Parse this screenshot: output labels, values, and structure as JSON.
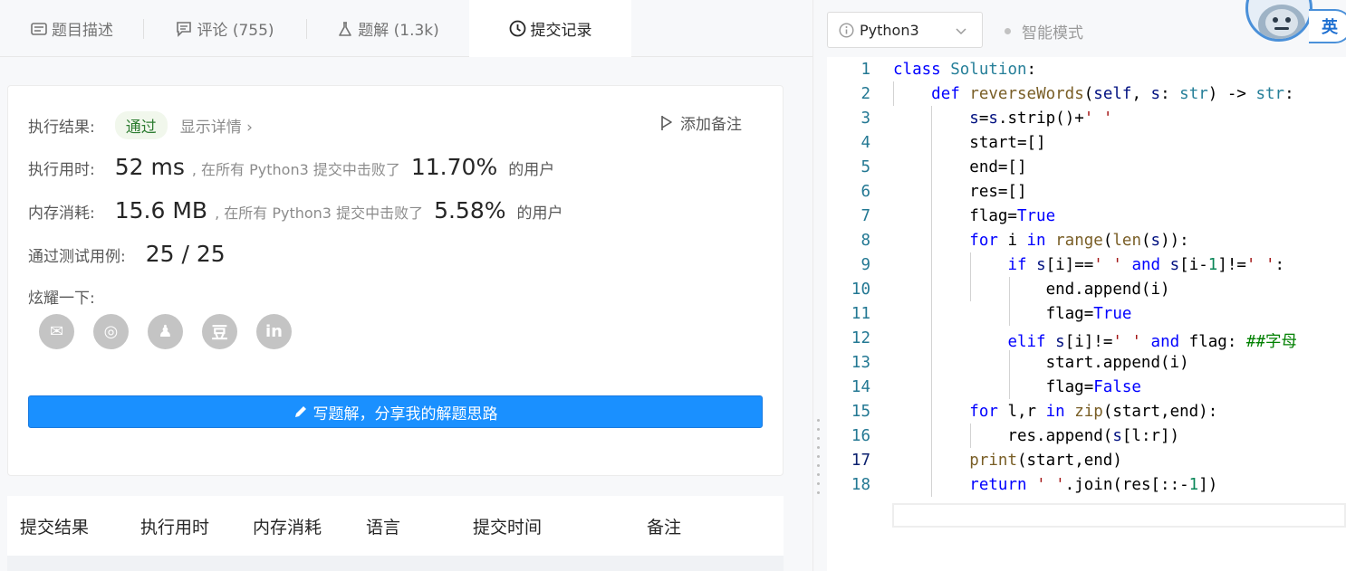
{
  "tabs": [
    {
      "label": "题目描述",
      "icon": "description-icon"
    },
    {
      "label": "评论 (755)",
      "icon": "comment-icon"
    },
    {
      "label": "题解 (1.3k)",
      "icon": "flask-icon"
    },
    {
      "label": "提交记录",
      "icon": "clock-icon"
    }
  ],
  "result": {
    "exec_label": "执行结果:",
    "status": "通过",
    "show_detail": "显示详情 ›",
    "add_note": "添加备注",
    "time_label": "执行用时:",
    "time_value": "52 ms",
    "time_desc": ", 在所有 Python3 提交中击败了",
    "time_pct": "11.70%",
    "users_suffix": "的用户",
    "mem_label": "内存消耗:",
    "mem_value": "15.6 MB",
    "mem_desc": ", 在所有 Python3 提交中击败了",
    "mem_pct": "5.58%",
    "tests_label": "通过测试用例:",
    "tests_value": "25 / 25",
    "share_label": "炫耀一下:",
    "share_icons": [
      "wechat-icon",
      "weibo-icon",
      "qq-icon",
      "douban-icon",
      "linkedin-icon"
    ],
    "share_glyphs": [
      "✉",
      "◎",
      "♟",
      "豆",
      "in"
    ],
    "write_button": "写题解，分享我的解题思路"
  },
  "table": {
    "headers": [
      "提交结果",
      "执行用时",
      "内存消耗",
      "语言",
      "提交时间",
      "备注"
    ]
  },
  "editor": {
    "language": "Python3",
    "mode": "智能模式",
    "ime": "英",
    "current_line": 17,
    "lines": [
      {
        "n": "1"
      },
      {
        "n": "2"
      },
      {
        "n": "3"
      },
      {
        "n": "4"
      },
      {
        "n": "5"
      },
      {
        "n": "6"
      },
      {
        "n": "7"
      },
      {
        "n": "8"
      },
      {
        "n": "9"
      },
      {
        "n": "10"
      },
      {
        "n": "11"
      },
      {
        "n": "12"
      },
      {
        "n": "13"
      },
      {
        "n": "14"
      },
      {
        "n": "15"
      },
      {
        "n": "16"
      },
      {
        "n": "17"
      },
      {
        "n": "18"
      }
    ],
    "code": {
      "l1": "class Solution:",
      "l2": "    def reverseWords(self, s: str) -> str:",
      "l3": "        s=s.strip()+' '",
      "l4": "        start=[]",
      "l5": "        end=[]",
      "l6": "        res=[]",
      "l7": "        flag=True",
      "l8": "        for i in range(len(s)):",
      "l9": "            if s[i]==' ' and s[i-1]!=' ':",
      "l10": "                end.append(i)",
      "l11": "                flag=True",
      "l12": "            elif s[i]!=' ' and flag: ##字母",
      "l13": "                start.append(i)",
      "l14": "                flag=False",
      "l15": "        for l,r in zip(start,end):",
      "l16": "            res.append(s[l:r])",
      "l17": "        print(start,end)",
      "l18": "        return ' '.join(res[::-1])"
    }
  }
}
